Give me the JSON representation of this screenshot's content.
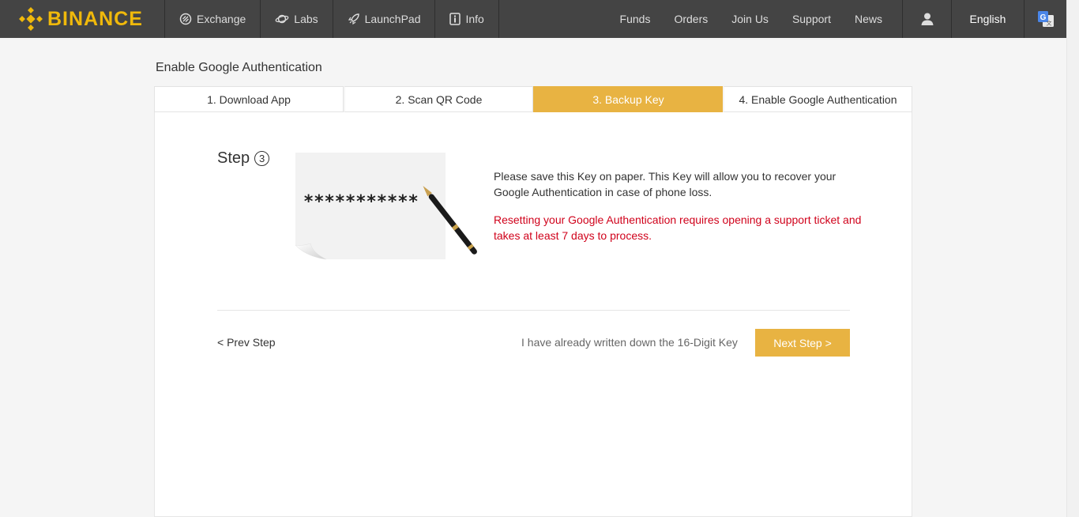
{
  "brand": {
    "name": "BINANCE",
    "color": "#F0B90B"
  },
  "nav": {
    "left": [
      {
        "label": "Exchange",
        "icon": "exchange-icon"
      },
      {
        "label": "Labs",
        "icon": "planet-icon"
      },
      {
        "label": "LaunchPad",
        "icon": "rocket-icon"
      },
      {
        "label": "Info",
        "icon": "info-icon"
      }
    ],
    "right": [
      "Funds",
      "Orders",
      "Join Us",
      "Support",
      "News"
    ],
    "user_icon": "user-icon",
    "language": "English",
    "translate_icon": "google-translate-icon"
  },
  "page": {
    "title": "Enable Google Authentication",
    "steps": [
      {
        "label": "1. Download App",
        "active": false
      },
      {
        "label": "2. Scan QR Code",
        "active": false
      },
      {
        "label": "3. Backup Key",
        "active": true
      },
      {
        "label": "4. Enable Google Authentication",
        "active": false
      }
    ],
    "step_word": "Step",
    "step_number": "3",
    "masked_key": "***********",
    "description": "Please save this Key on paper. This Key will allow you to recover your Google Authentication in case of phone loss.",
    "warning": "Resetting your Google Authentication requires opening a support ticket and takes at least 7 days to process.",
    "prev_label": "< Prev Step",
    "confirm_text": "I have already written down the 16-Digit Key",
    "next_label": "Next Step >"
  },
  "colors": {
    "accent": "#E8B342",
    "warning": "#d0021b",
    "nav_bg": "#444444"
  }
}
